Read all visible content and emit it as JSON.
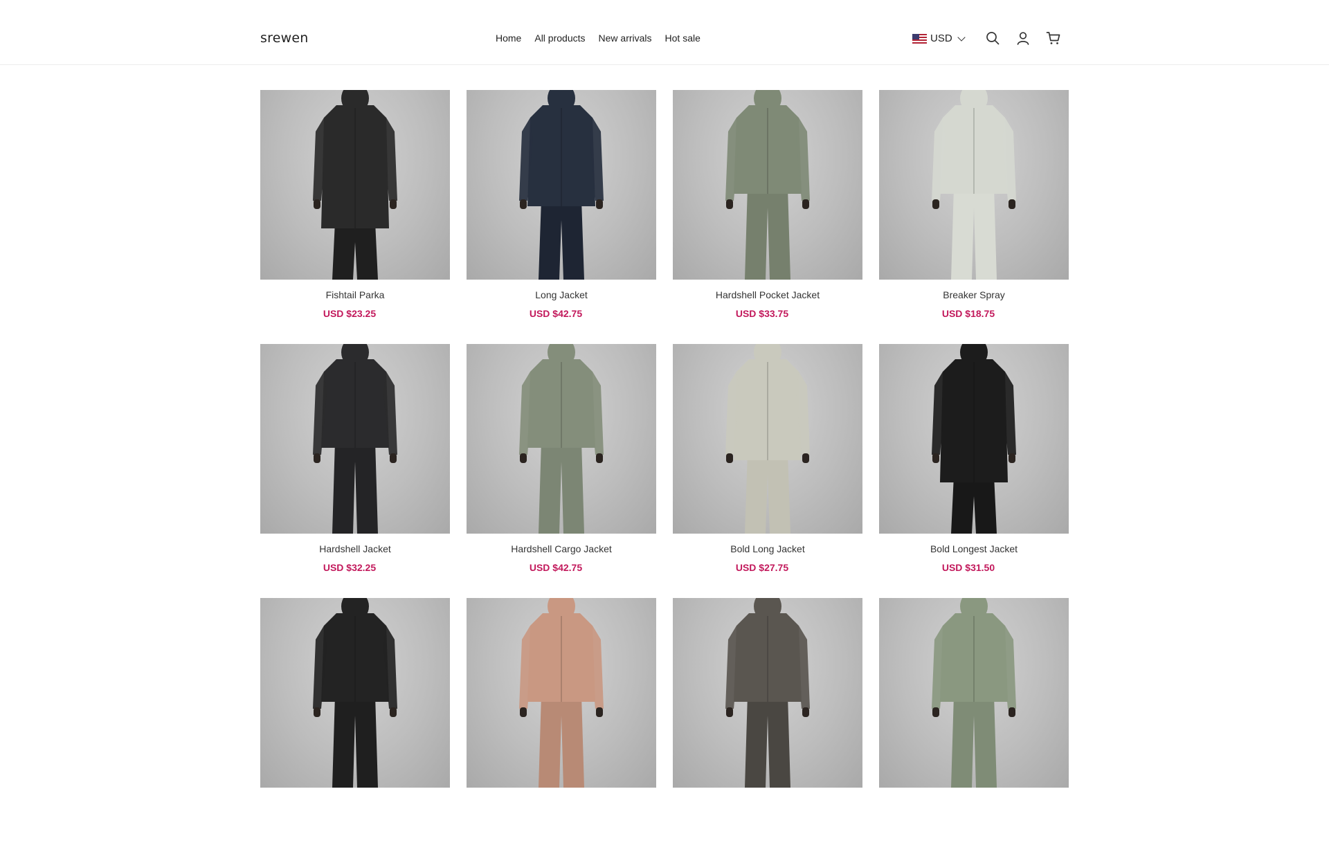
{
  "header": {
    "logo": "srewen",
    "nav": [
      "Home",
      "All products",
      "New arrivals",
      "Hot sale"
    ],
    "currency": "USD",
    "icons": [
      "search-icon",
      "account-icon",
      "cart-icon"
    ]
  },
  "products": [
    {
      "name": "Fishtail Parka",
      "price": "USD $23.25",
      "color": "#2a2a2a",
      "pants": "#1f1f1f",
      "style": "long"
    },
    {
      "name": "Long Jacket",
      "price": "USD $42.75",
      "color": "#27303f",
      "pants": "#1e2533",
      "style": "mid"
    },
    {
      "name": "Hardshell Pocket Jacket",
      "price": "USD $33.75",
      "color": "#7f8a76",
      "pants": "#76806d",
      "style": "short"
    },
    {
      "name": "Breaker Spray",
      "price": "USD $18.75",
      "color": "#d5d8d0",
      "pants": "#d8dbd3",
      "style": "short"
    },
    {
      "name": "Hardshell Jacket",
      "price": "USD $32.25",
      "color": "#2b2b2d",
      "pants": "#242426",
      "style": "short"
    },
    {
      "name": "Hardshell Cargo Jacket",
      "price": "USD $42.75",
      "color": "#848e7b",
      "pants": "#7c8674",
      "style": "short"
    },
    {
      "name": "Bold Long Jacket",
      "price": "USD $27.75",
      "color": "#c9c9bd",
      "pants": "#c2c1b4",
      "style": "mid"
    },
    {
      "name": "Bold Longest Jacket",
      "price": "USD $31.50",
      "color": "#1c1c1c",
      "pants": "#181818",
      "style": "long"
    },
    {
      "name": "",
      "price": "",
      "color": "#232323",
      "pants": "#1f1f1f",
      "style": "short"
    },
    {
      "name": "",
      "price": "",
      "color": "#c99882",
      "pants": "#b88a75",
      "style": "short"
    },
    {
      "name": "",
      "price": "",
      "color": "#5a5650",
      "pants": "#4a4742",
      "style": "short"
    },
    {
      "name": "",
      "price": "",
      "color": "#8a9880",
      "pants": "#7f8c76",
      "style": "short"
    }
  ]
}
